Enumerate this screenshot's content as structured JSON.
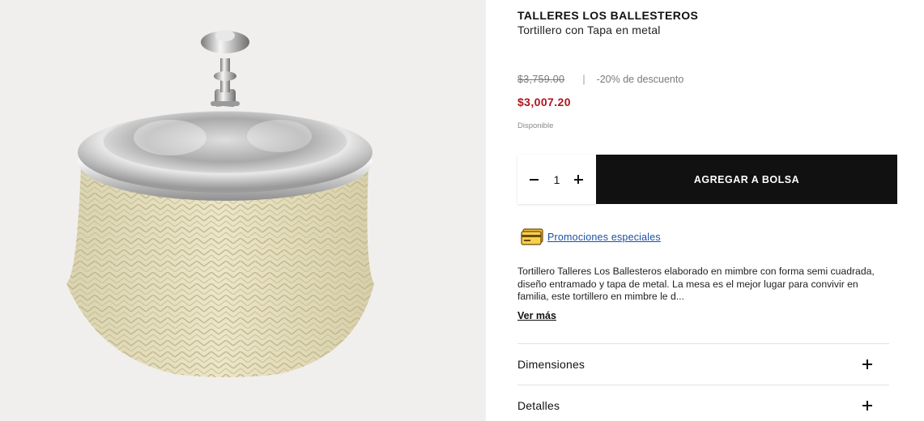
{
  "product": {
    "brand": "TALLERES LOS BALLESTEROS",
    "name": "Tortillero con Tapa en metal",
    "original_price": "$3,759.00",
    "separator": "|",
    "discount": "-20% de descuento",
    "sale_price": "$3,007.20",
    "availability": "Disponible",
    "image_icon": "woven-tortilla-basket-with-metal-lid"
  },
  "cart": {
    "quantity": "1",
    "decrement_icon": "minus-icon",
    "increment_icon": "plus-icon",
    "add_button_label": "AGREGAR A BOLSA"
  },
  "promotions": {
    "icon": "credit-card-icon",
    "link_label": "Promociones especiales"
  },
  "description": {
    "text": "Tortillero Talleres Los Ballesteros elaborado en mimbre con forma semi cuadrada, diseño entramado y tapa de metal. La mesa es el mejor lugar para convivir en familia, este tortillero en mimbre le d...",
    "more_label": "Ver más"
  },
  "accordions": [
    {
      "label": "Dimensiones",
      "icon": "plus-icon"
    },
    {
      "label": "Detalles",
      "icon": "plus-icon"
    }
  ],
  "colors": {
    "sale_price": "#b0141c",
    "button_bg": "#111111",
    "link": "#1c4fa3",
    "image_bg": "#f1efed"
  }
}
